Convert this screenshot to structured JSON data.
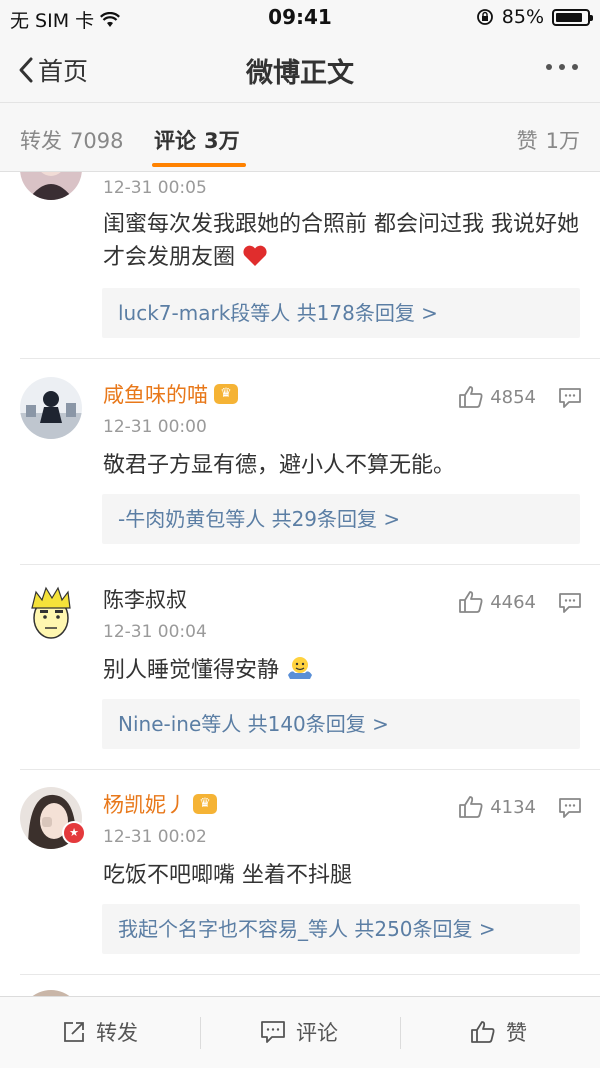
{
  "status_bar": {
    "carrier": "无 SIM 卡",
    "time": "09:41",
    "battery": "85%"
  },
  "nav": {
    "back_label": "首页",
    "title": "微博正文"
  },
  "tabs": {
    "repost_label": "转发",
    "repost_count": "7098",
    "comment_label": "评论",
    "comment_count": "3万",
    "like_label": "赞",
    "like_count": "1万"
  },
  "comments": [
    {
      "time": "12-31 00:05",
      "text": "闺蜜每次发我跟她的合照前 都会问过我 我说好她才会发朋友圈",
      "replies": "luck7-mark段等人  共178条回复 >"
    },
    {
      "name": "咸鱼味的喵",
      "time": "12-31 00:00",
      "likes": "4854",
      "text": "敬君子方显有德，避小人不算无能。",
      "replies": "-牛肉奶黄包等人  共29条回复 >"
    },
    {
      "name": "陈李叔叔",
      "time": "12-31 00:04",
      "likes": "4464",
      "text": "别人睡觉懂得安静",
      "replies": "Nine-ine等人  共140条回复 >"
    },
    {
      "name": "杨凯妮丿",
      "time": "12-31 00:02",
      "likes": "4134",
      "text": "吃饭不吧唧嘴 坐着不抖腿",
      "replies": "我起个名字也不容易_等人  共250条回复 >"
    }
  ],
  "bottom_bar": {
    "repost": "转发",
    "comment": "评论",
    "like": "赞"
  },
  "colors": {
    "accent": "#ff8200",
    "username_vip": "#e8781a",
    "reply_link": "#5b7ea4"
  }
}
